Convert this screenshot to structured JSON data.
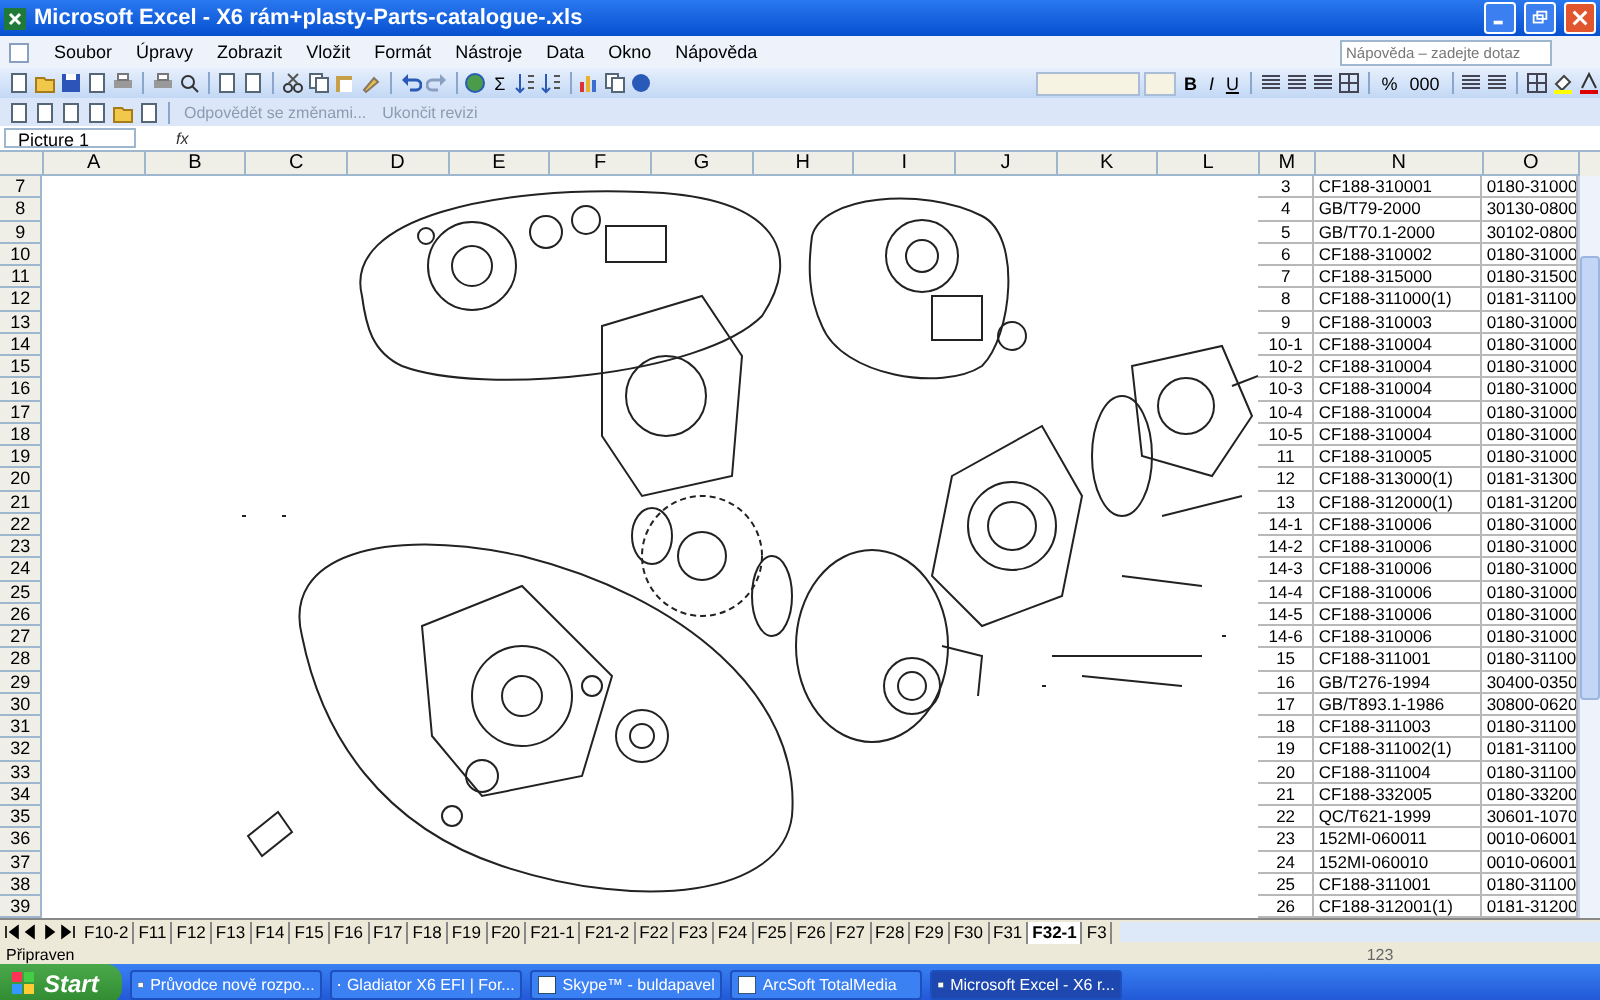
{
  "window": {
    "title": "Microsoft Excel - X6  rám+plasty-Parts-catalogue-.xls"
  },
  "menu": {
    "items": [
      "Soubor",
      "Úpravy",
      "Zobrazit",
      "Vložit",
      "Formát",
      "Nástroje",
      "Data",
      "Okno",
      "Nápověda"
    ],
    "help_box": {
      "placeholder": "Nápověda – zadejte dotaz"
    }
  },
  "standard_toolbar": {
    "sum_symbol": "Σ"
  },
  "formatting_toolbar": {
    "buttons": [
      "B",
      "I",
      "U",
      "%",
      "000"
    ]
  },
  "review_toolbar": {
    "reply": "Odpovědět se změnami...",
    "end_review": "Ukončit revizi",
    "disabled": true
  },
  "formula_bar": {
    "name_box": "Picture 1",
    "function_symbol": "fx"
  },
  "sheet": {
    "columns": [
      "A",
      "B",
      "C",
      "D",
      "E",
      "F",
      "G",
      "H",
      "I",
      "J",
      "K",
      "L",
      "M",
      "N",
      "O"
    ],
    "row_numbers": [
      "7",
      "8",
      "9",
      "10",
      "11",
      "12",
      "13",
      "14",
      "15",
      "16",
      "17",
      "18",
      "19",
      "20",
      "21",
      "22",
      "23",
      "24",
      "25",
      "26",
      "27",
      "28",
      "29",
      "30",
      "31",
      "32",
      "33",
      "34",
      "35",
      "36",
      "37",
      "38",
      "39"
    ],
    "table": [
      {
        "m": "3",
        "n": "CF188-310001",
        "o": "0180-31000"
      },
      {
        "m": "4",
        "n": "GB/T79-2000",
        "o": "30130-0800"
      },
      {
        "m": "5",
        "n": "GB/T70.1-2000",
        "o": "30102-0800"
      },
      {
        "m": "6",
        "n": "CF188-310002",
        "o": "0180-31000"
      },
      {
        "m": "7",
        "n": "CF188-315000",
        "o": "0180-31500"
      },
      {
        "m": "8",
        "n": "CF188-311000(1)",
        "o": "0181-31100"
      },
      {
        "m": "9",
        "n": "CF188-310003",
        "o": "0180-31000"
      },
      {
        "m": "10-1",
        "n": "CF188-310004",
        "o": "0180-31000"
      },
      {
        "m": "10-2",
        "n": "CF188-310004",
        "o": "0180-31000"
      },
      {
        "m": "10-3",
        "n": "CF188-310004",
        "o": "0180-31000"
      },
      {
        "m": "10-4",
        "n": "CF188-310004",
        "o": "0180-31000"
      },
      {
        "m": "10-5",
        "n": "CF188-310004",
        "o": "0180-31000"
      },
      {
        "m": "11",
        "n": "CF188-310005",
        "o": "0180-31000"
      },
      {
        "m": "12",
        "n": "CF188-313000(1)",
        "o": "0181-31300"
      },
      {
        "m": "13",
        "n": "CF188-312000(1)",
        "o": "0181-31200"
      },
      {
        "m": "14-1",
        "n": "CF188-310006",
        "o": "0180-31000"
      },
      {
        "m": "14-2",
        "n": "CF188-310006",
        "o": "0180-31000"
      },
      {
        "m": "14-3",
        "n": "CF188-310006",
        "o": "0180-31000"
      },
      {
        "m": "14-4",
        "n": "CF188-310006",
        "o": "0180-31000"
      },
      {
        "m": "14-5",
        "n": "CF188-310006",
        "o": "0180-31000"
      },
      {
        "m": "14-6",
        "n": "CF188-310006",
        "o": "0180-31000"
      },
      {
        "m": "15",
        "n": "CF188-311001",
        "o": "0180-31100"
      },
      {
        "m": "16",
        "n": "GB/T276-1994",
        "o": "30400-0350"
      },
      {
        "m": "17",
        "n": "GB/T893.1-1986",
        "o": "30800-0620"
      },
      {
        "m": "18",
        "n": "CF188-311003",
        "o": "0180-31100"
      },
      {
        "m": "19",
        "n": "CF188-311002(1)",
        "o": "0181-31100"
      },
      {
        "m": "20",
        "n": "CF188-311004",
        "o": "0180-31100"
      },
      {
        "m": "21",
        "n": "CF188-332005",
        "o": "0180-33200"
      },
      {
        "m": "22",
        "n": "QC/T621-1999",
        "o": "30601-1070"
      },
      {
        "m": "23",
        "n": "152MI-060011",
        "o": "0010-06001"
      },
      {
        "m": "24",
        "n": "152MI-060010",
        "o": "0010-06001"
      },
      {
        "m": "25",
        "n": "CF188-311001",
        "o": "0180-31100"
      },
      {
        "m": "26",
        "n": "CF188-312001(1)",
        "o": "0181-31200"
      }
    ]
  },
  "sheet_tabs": [
    {
      "label": "F10-2",
      "selected": false
    },
    {
      "label": "F11",
      "selected": false
    },
    {
      "label": "F12",
      "selected": false
    },
    {
      "label": "F13",
      "selected": false
    },
    {
      "label": "F14",
      "selected": false
    },
    {
      "label": "F15",
      "selected": false
    },
    {
      "label": "F16",
      "selected": false
    },
    {
      "label": "F17",
      "selected": false
    },
    {
      "label": "F18",
      "selected": false
    },
    {
      "label": "F19",
      "selected": false
    },
    {
      "label": "F20",
      "selected": false
    },
    {
      "label": "F21-1",
      "selected": false
    },
    {
      "label": "F21-2",
      "selected": false
    },
    {
      "label": "F22",
      "selected": false
    },
    {
      "label": "F23",
      "selected": false
    },
    {
      "label": "F24",
      "selected": false
    },
    {
      "label": "F25",
      "selected": false
    },
    {
      "label": "F26",
      "selected": false
    },
    {
      "label": "F27",
      "selected": false
    },
    {
      "label": "F28",
      "selected": false
    },
    {
      "label": "F29",
      "selected": false
    },
    {
      "label": "F30",
      "selected": false
    },
    {
      "label": "F31",
      "selected": false
    },
    {
      "label": "F32-1",
      "selected": true
    },
    {
      "label": "F3",
      "selected": false
    }
  ],
  "status_bar": {
    "text": "Připraven",
    "indicator": "123"
  },
  "taskbar": {
    "start": "Start",
    "tasks": [
      {
        "label": "Průvodce nově rozpo...",
        "selected": false
      },
      {
        "label": "Gladiator X6 EFI | For...",
        "selected": false
      },
      {
        "label": "Skype™ - buldapavel",
        "selected": false
      },
      {
        "label": "ArcSoft TotalMedia",
        "selected": false
      },
      {
        "label": "Microsoft Excel - X6  r...",
        "selected": true
      }
    ]
  }
}
